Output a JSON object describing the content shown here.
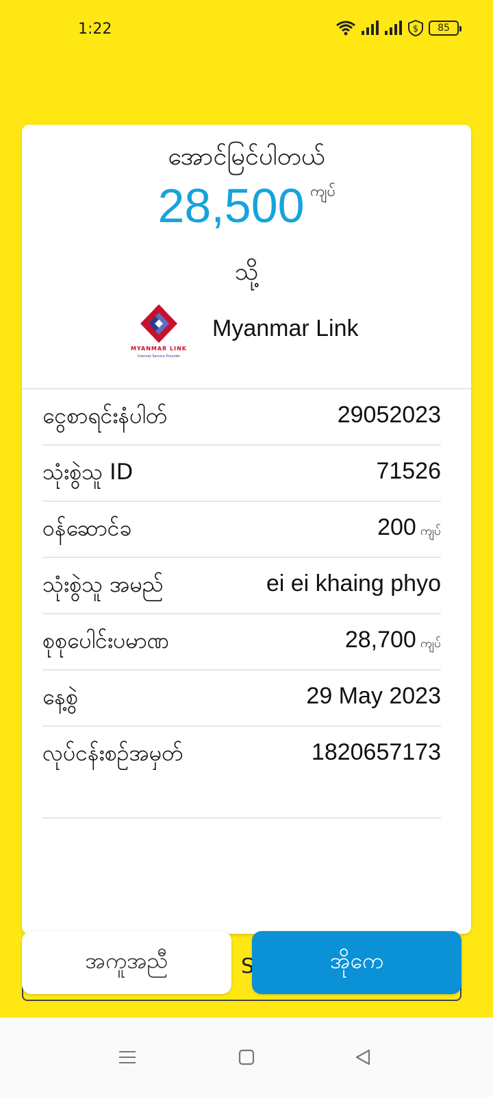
{
  "status_bar": {
    "time": "1:22",
    "battery": "85"
  },
  "receipt": {
    "title": "အောင်မြင်ပါတယ်",
    "amount": "28,500",
    "amount_unit": "ကျပ်",
    "to_label": "သို့",
    "recipient": {
      "name": "Myanmar Link",
      "logo_text": "MYANMAR LINK",
      "logo_subtext": "Internet Service Provider",
      "logo_colors": [
        "#c8102e",
        "#2a3d8f"
      ]
    },
    "details": [
      {
        "label": "ငွေစာရင်းနံပါတ်",
        "value": "29052023",
        "unit": ""
      },
      {
        "label": "သုံးစွဲသူ ID",
        "value": "71526",
        "unit": ""
      },
      {
        "label": "ဝန်ဆောင်ခ",
        "value": "200",
        "unit": "ကျပ်"
      },
      {
        "label": "သုံးစွဲသူ အမည်",
        "value": "ei ei khaing phyo",
        "unit": ""
      },
      {
        "label": "စုစုပေါင်းပမာဏ",
        "value": "28,700",
        "unit": "ကျပ်"
      },
      {
        "label": "နေ့စွဲ",
        "value": "29 May 2023",
        "unit": ""
      },
      {
        "label": "လုပ်ငန်းစဉ်အမှတ်",
        "value": "1820657173",
        "unit": ""
      }
    ]
  },
  "buttons": {
    "help_label": "အကူအညီ",
    "ok_label": "အိုကေ",
    "hidden_text": "S"
  },
  "colors": {
    "background": "#ffe714",
    "accent": "#16a3dc",
    "ok_button": "#0a91d6"
  },
  "nav_bar": {
    "icons": [
      "menu-icon",
      "home-icon",
      "back-icon"
    ]
  }
}
